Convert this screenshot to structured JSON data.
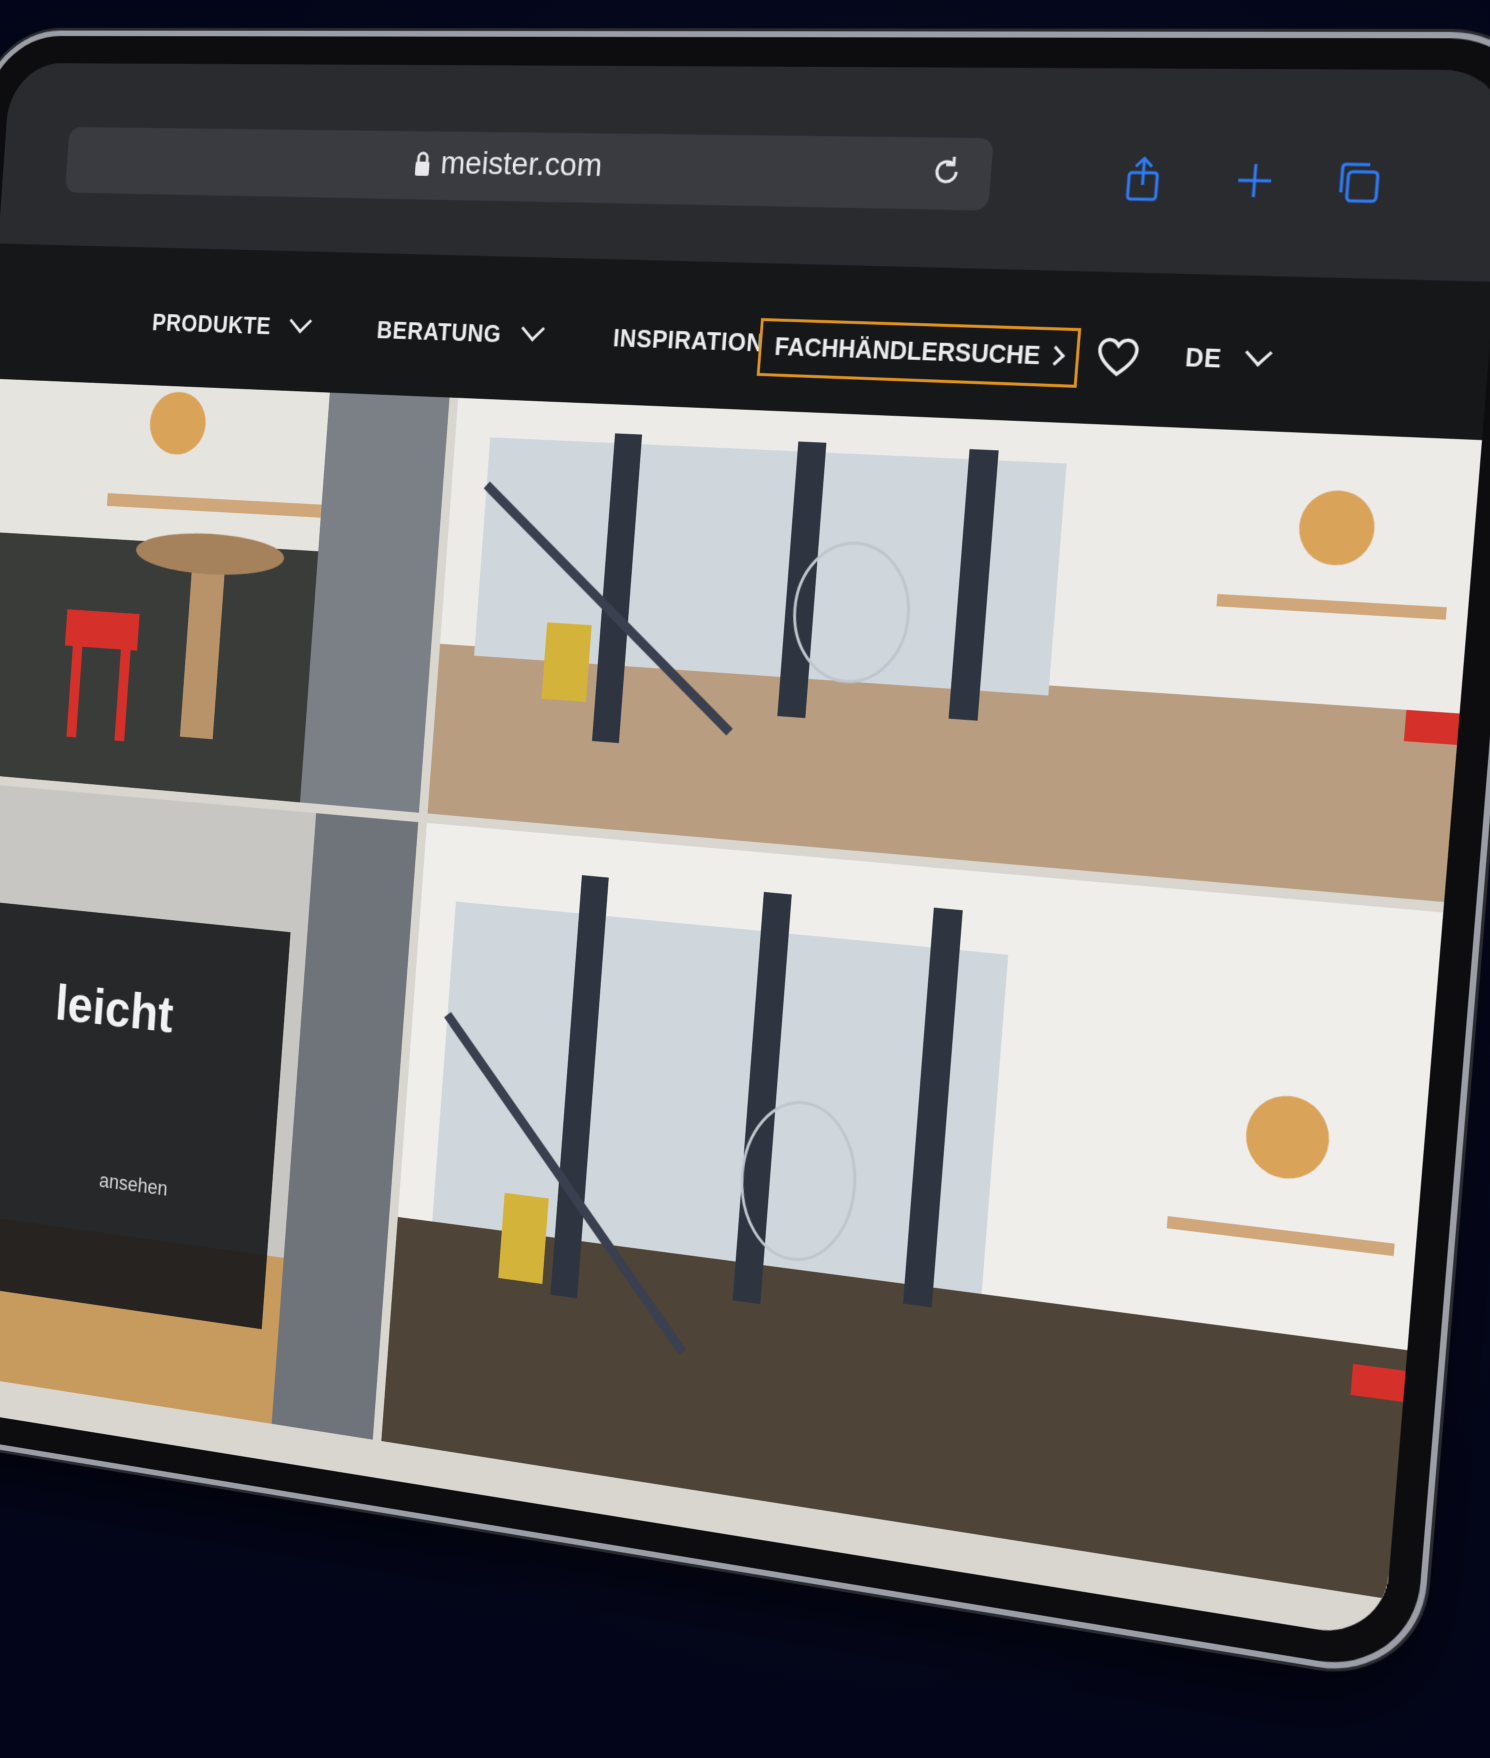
{
  "browser": {
    "url": "meister.com"
  },
  "nav": {
    "products": "PRODUKTE",
    "advice": "BERATUNG",
    "inspiration": "INSPIRATION",
    "dealer_search": "FACHHÄNDLERSUCHE",
    "language": "DE"
  },
  "hero": {
    "title_fragment": "leicht",
    "link_fragment": "ansehen"
  },
  "colors": {
    "accent": "#e0921f",
    "safari_blue": "#2f7bf6",
    "nav_bg": "#161719",
    "toolbar_bg": "#2a2b2f"
  }
}
